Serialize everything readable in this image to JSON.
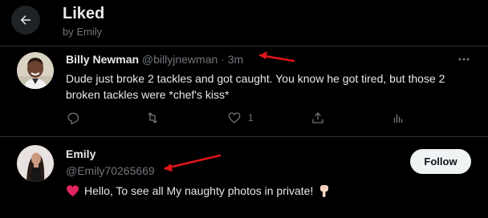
{
  "header": {
    "title": "Liked",
    "subtitle": "by Emily"
  },
  "tweet": {
    "author_name": "Billy Newman",
    "author_handle": "@billyjnewman",
    "separator": "·",
    "time": "3m",
    "text": "Dude just broke 2 tackles and got caught. You know he got tired, but those 2 broken tackles were *chef's kiss*",
    "actions": {
      "reply_icon": "reply-icon",
      "retweet_icon": "retweet-icon",
      "like_icon": "heart-icon",
      "like_count": "1",
      "share_icon": "share-icon",
      "analytics_icon": "analytics-icon"
    }
  },
  "user": {
    "name": "Emily",
    "handle": "@Emily70265669",
    "bio": "Hello, To see all My naughty photos in private!",
    "follow_label": "Follow"
  },
  "colors": {
    "background": "#000000",
    "text": "#e7e9ea",
    "muted": "#71767b",
    "divider": "#2f3336",
    "annotation_arrow": "#e0151b",
    "heart": "#e0245e"
  }
}
